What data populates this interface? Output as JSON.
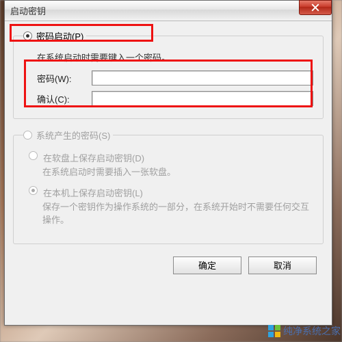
{
  "window": {
    "title": "启动密钥"
  },
  "group1": {
    "legend": "密码启动(P)",
    "desc": "在系统启动时需要键入一个密码。",
    "password_label": "密码(W):",
    "confirm_label": "确认(C):",
    "password_value": "",
    "confirm_value": ""
  },
  "group2": {
    "legend": "系统产生的密码(S)",
    "opt_floppy_label": "在软盘上保存启动密钥(D)",
    "opt_floppy_desc": "在系统启动时需要插入一张软盘。",
    "opt_local_label": "在本机上保存启动密钥(L)",
    "opt_local_desc": "保存一个密钥作为操作系统的一部分，在系统开始时不需要任何交互操作。"
  },
  "buttons": {
    "ok": "确定",
    "cancel": "取消"
  },
  "watermark": "纯净系统之家"
}
